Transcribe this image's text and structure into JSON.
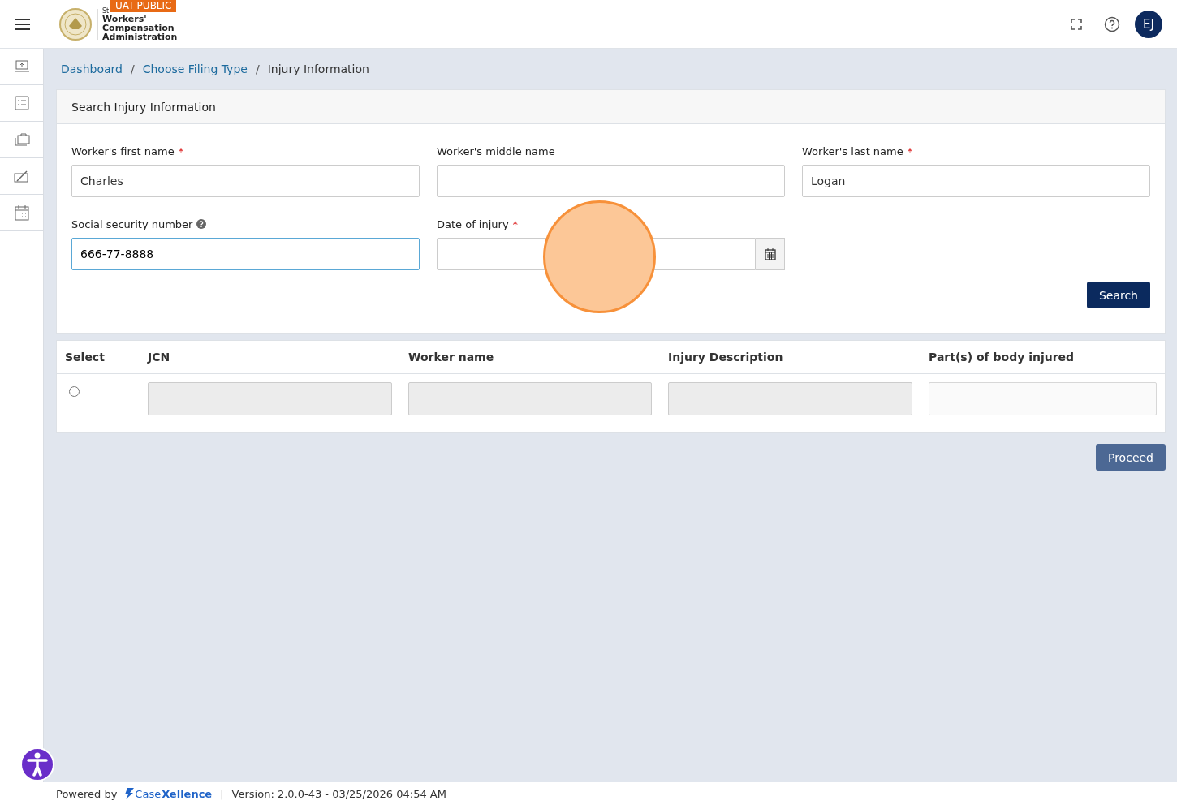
{
  "header": {
    "env_badge": "UAT-PUBLIC",
    "logo_small": "St",
    "logo_lines": [
      "Workers'",
      "Compensation",
      "Administration"
    ],
    "avatar": "EJ"
  },
  "sidebar": {
    "items": [
      {
        "kind": "upload"
      },
      {
        "kind": "list"
      },
      {
        "kind": "briefcase"
      },
      {
        "kind": "edit"
      },
      {
        "kind": "calendar"
      }
    ]
  },
  "breadcrumb": [
    {
      "label": "Dashboard",
      "link": true,
      "separator": "/"
    },
    {
      "label": "Choose Filing Type",
      "link": true,
      "separator": "/"
    },
    {
      "label": "Injury Information",
      "link": false
    }
  ],
  "search_card": {
    "title": "Search Injury Information",
    "fields": [
      {
        "label": "Worker's first name",
        "required_mark": "*",
        "value": "Charles",
        "kind": "text",
        "focused": false
      },
      {
        "label": "Worker's middle name",
        "kind": "text",
        "focused": false
      },
      {
        "label": "Worker's last name",
        "required_mark": "*",
        "value": "Logan",
        "kind": "text",
        "focused": false
      },
      {
        "label": "Social security number",
        "value": "666-77-8888",
        "kind": "help",
        "focused": true
      },
      {
        "label": "Date of injury",
        "required_mark": "*",
        "kind": "date",
        "focused": false
      }
    ],
    "button": "Search"
  },
  "table": {
    "columns": [
      "Select",
      "JCN",
      "Worker name",
      "Injury Description",
      "Part(s) of body injured"
    ],
    "rows": [
      {
        "selected": false,
        "cells": [
          {
            "disabled": true
          },
          {
            "disabled": true
          },
          {
            "disabled": true
          },
          {
            "disabled": false
          }
        ]
      }
    ]
  },
  "proceed_button": "Proceed",
  "footer": {
    "powered_by": "Powered by",
    "brand_first": "Case",
    "brand_second": "Xellence",
    "separator": "|",
    "version": "Version: 2.0.0-43 - 03/25/2026 04:54 AM"
  }
}
